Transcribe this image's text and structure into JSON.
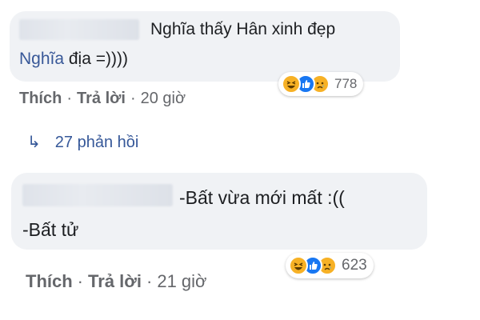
{
  "comments": [
    {
      "line1": "Nghĩa thấy Hân xinh đẹp",
      "mention": "Nghĩa",
      "line2_rest": " địa =))))",
      "reaction_count": "778",
      "reactions": [
        "haha-icon",
        "like-icon",
        "sad-icon"
      ],
      "actions": {
        "like": "Thích",
        "reply": "Trả lời",
        "time": "20 giờ"
      }
    },
    {
      "line1": "-Bất vừa mới mất :((",
      "line2": "-Bất tử",
      "reaction_count": "623",
      "reactions": [
        "haha-icon",
        "like-icon",
        "sad-icon"
      ],
      "actions": {
        "like": "Thích",
        "reply": "Trả lời",
        "time": "21 giờ"
      }
    }
  ],
  "replies_link": {
    "arrow": "↳",
    "label": "27 phản hồi"
  },
  "separator": "·",
  "colors": {
    "bubble": "#f0f2f5",
    "mention": "#385898",
    "link": "#365899",
    "meta": "#65676b"
  }
}
